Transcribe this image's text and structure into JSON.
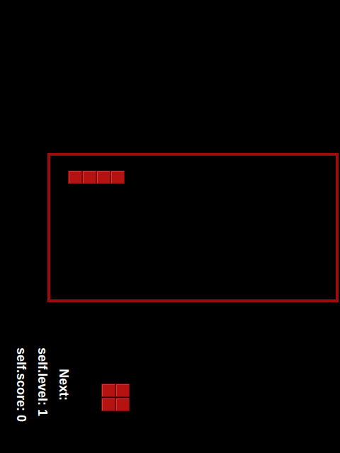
{
  "board": {
    "active_piece": {
      "shape": "I",
      "cells": [
        [
          0,
          0
        ],
        [
          1,
          0
        ],
        [
          2,
          0
        ],
        [
          3,
          0
        ]
      ]
    }
  },
  "hud": {
    "score_text": "self.score: 0",
    "level_text": "self.level: 1",
    "next_label": "Next:"
  },
  "next_piece": {
    "shape": "O",
    "cells": [
      [
        0,
        0
      ],
      [
        1,
        0
      ],
      [
        0,
        1
      ],
      [
        1,
        1
      ]
    ]
  }
}
